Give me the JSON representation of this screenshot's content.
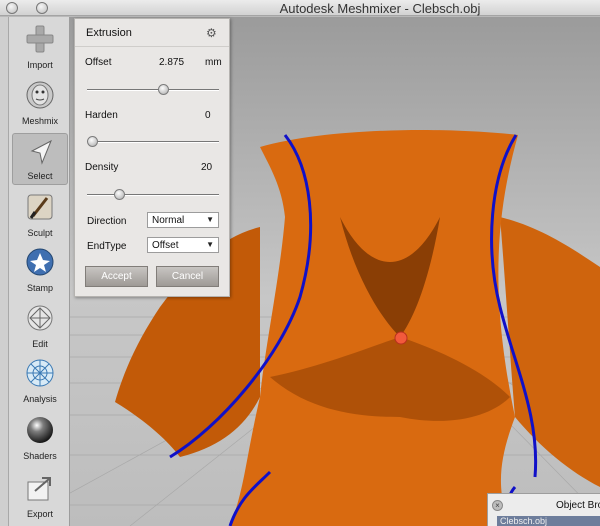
{
  "window": {
    "title": "Autodesk Meshmixer - Clebsch.obj"
  },
  "toolbar": {
    "tools": [
      {
        "label": "Import",
        "icon": "plus-icon"
      },
      {
        "label": "Meshmix",
        "icon": "meshmix-head-icon"
      },
      {
        "label": "Select",
        "icon": "select-arrow-icon",
        "active": true
      },
      {
        "label": "Sculpt",
        "icon": "sculpt-brush-icon"
      },
      {
        "label": "Stamp",
        "icon": "stamp-icon"
      },
      {
        "label": "Edit",
        "icon": "edit-icon"
      },
      {
        "label": "Analysis",
        "icon": "analysis-icon"
      },
      {
        "label": "Shaders",
        "icon": "shader-sphere-icon"
      },
      {
        "label": "Export",
        "icon": "export-icon"
      }
    ]
  },
  "panel": {
    "title": "Extrusion",
    "offset": {
      "label": "Offset",
      "value": "2.875",
      "unit": "mm",
      "slider_fraction": 0.58
    },
    "harden": {
      "label": "Harden",
      "value": "0",
      "slider_fraction": 0.0
    },
    "density": {
      "label": "Density",
      "value": "20",
      "slider_fraction": 0.22
    },
    "direction": {
      "label": "Direction",
      "value": "Normal"
    },
    "endtype": {
      "label": "EndType",
      "value": "Offset"
    },
    "accept_label": "Accept",
    "cancel_label": "Cancel"
  },
  "object_browser": {
    "title": "Object Bro",
    "item": "Clebsch.obj"
  },
  "colors": {
    "mesh": "#d96a10",
    "boundary": "#1010c8",
    "annotation_arrow": "#dd1111"
  }
}
